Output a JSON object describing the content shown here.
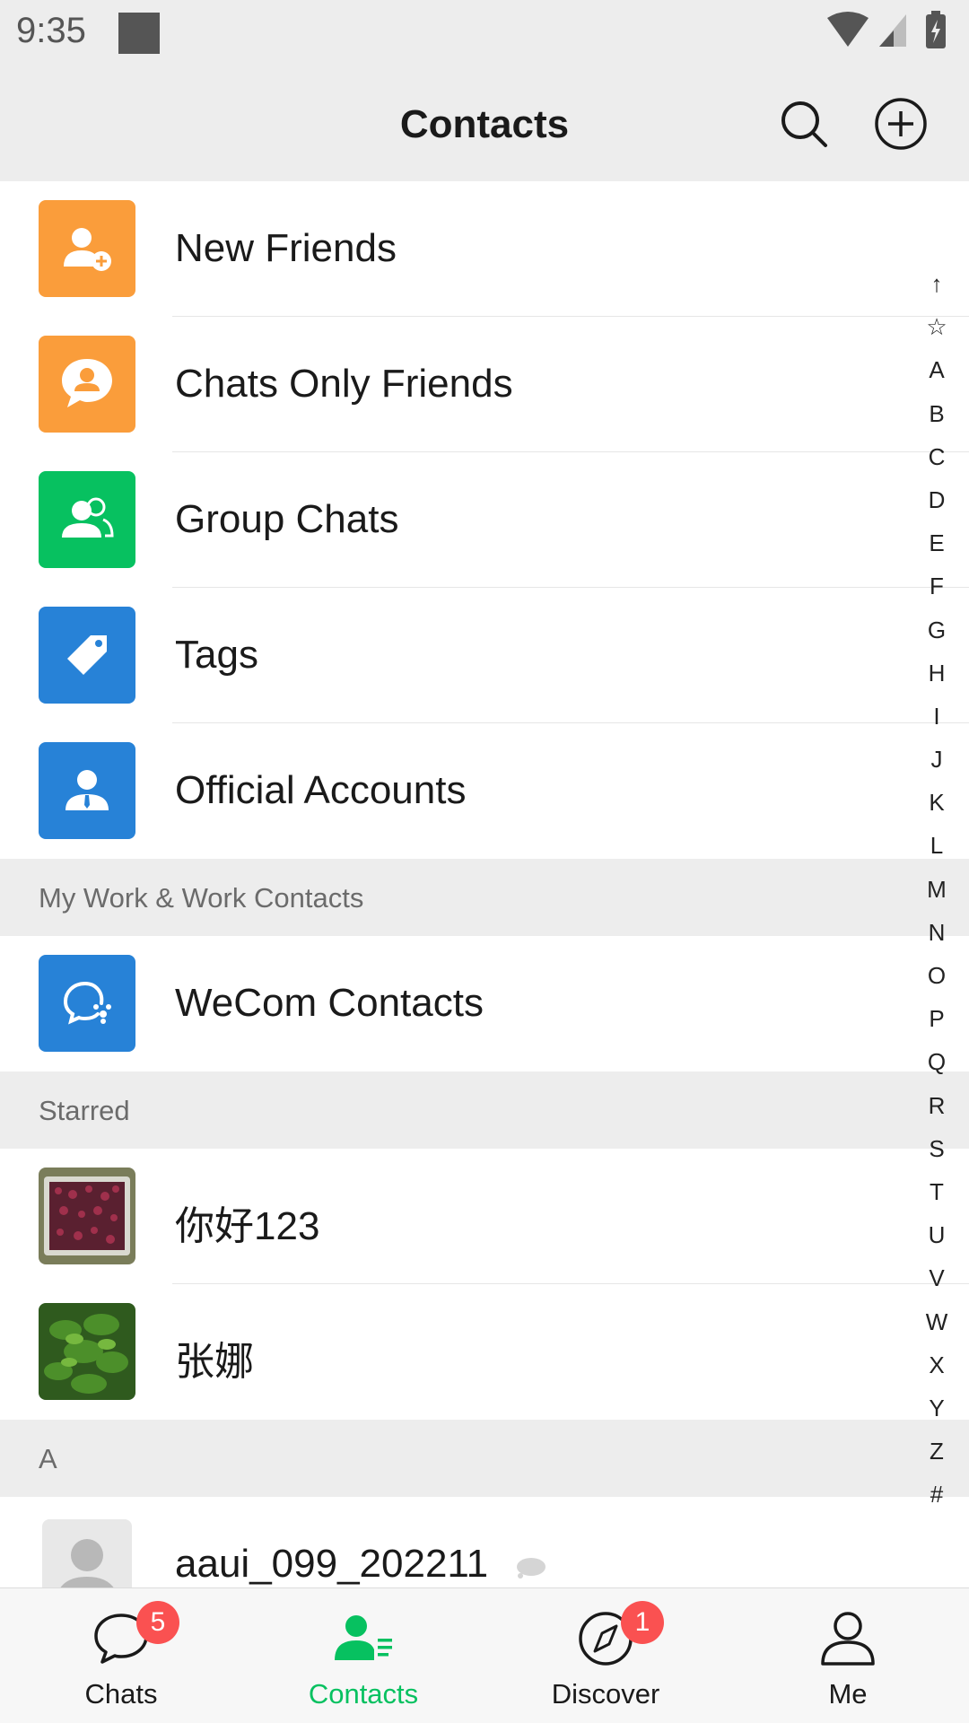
{
  "status_bar": {
    "time": "9:35"
  },
  "header": {
    "title": "Contacts"
  },
  "fixed_items": [
    {
      "label": "New Friends",
      "icon": "add-friend-icon",
      "color": "#fa9d3b"
    },
    {
      "label": "Chats Only Friends",
      "icon": "chat-person-icon",
      "color": "#fa9d3b"
    },
    {
      "label": "Group Chats",
      "icon": "group-icon",
      "color": "#07c160"
    },
    {
      "label": "Tags",
      "icon": "tag-icon",
      "color": "#2782d7"
    },
    {
      "label": "Official Accounts",
      "icon": "official-account-icon",
      "color": "#2782d7"
    }
  ],
  "sections": {
    "work": "My Work & Work Contacts",
    "starred": "Starred",
    "a": "A"
  },
  "work_items": [
    {
      "label": "WeCom Contacts",
      "icon": "wecom-icon",
      "color": "#2782d7"
    }
  ],
  "starred_items": [
    {
      "name": "你好123"
    },
    {
      "name": "张娜"
    }
  ],
  "a_items": [
    {
      "name": "aaui_099_202211"
    }
  ],
  "index": [
    "↑",
    "☆",
    "A",
    "B",
    "C",
    "D",
    "E",
    "F",
    "G",
    "H",
    "I",
    "J",
    "K",
    "L",
    "M",
    "N",
    "O",
    "P",
    "Q",
    "R",
    "S",
    "T",
    "U",
    "V",
    "W",
    "X",
    "Y",
    "Z",
    "#"
  ],
  "tabs": [
    {
      "label": "Chats",
      "badge": "5"
    },
    {
      "label": "Contacts",
      "badge": ""
    },
    {
      "label": "Discover",
      "badge": "1"
    },
    {
      "label": "Me",
      "badge": ""
    }
  ],
  "colors": {
    "accent": "#07c160",
    "badge": "#fa5151",
    "orange": "#fa9d3b",
    "blue": "#2782d7"
  }
}
